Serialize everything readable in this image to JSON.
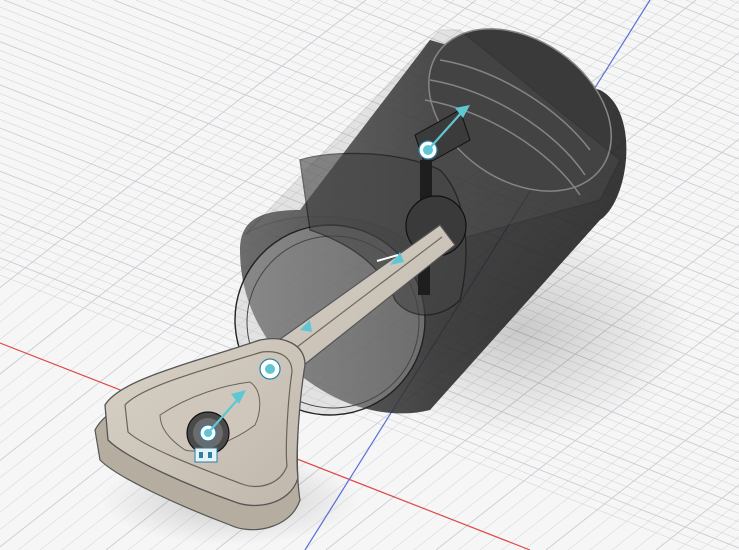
{
  "viewport": {
    "background": "#f6f6f6",
    "grid_color": "#c9cdd2",
    "axis_x_color": "#e04848",
    "axis_y_color": "#5a6fd8"
  },
  "model": {
    "body_color": "#d2cbc0",
    "body_dark": "#a79f93",
    "cylinder_color": "#2c2c2c",
    "joint_color": "#5ec7d3",
    "connector_color": "#e7f2f5"
  }
}
